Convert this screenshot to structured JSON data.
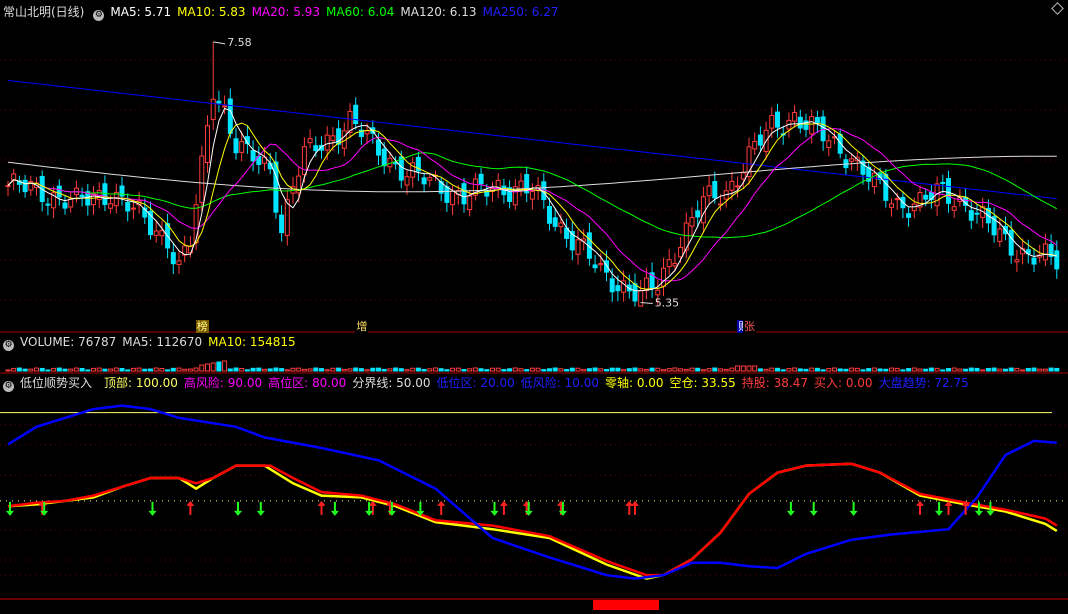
{
  "colors": {
    "background": "#000000",
    "grid": "#6a0000",
    "candle_up": "#ff3b3b",
    "candle_down": "#00e5ff",
    "ma5": "#ffffff",
    "ma10": "#ffff00",
    "ma20": "#ff00ff",
    "ma60": "#00ff00",
    "ma120": "#dddddd",
    "ma250": "#0000ff",
    "sell_line": "#ffff00",
    "buy_line": "#ff0000",
    "market_line": "#0000ff",
    "level_line": "#ffff66"
  },
  "price_header": {
    "title": "常山北明(日线)",
    "items": [
      {
        "label": "MA5: 5.71",
        "color": "#ffffff"
      },
      {
        "label": "MA10: 5.83",
        "color": "#ffff00"
      },
      {
        "label": "MA20: 5.93",
        "color": "#ff00ff"
      },
      {
        "label": "MA60: 6.04",
        "color": "#00ff00"
      },
      {
        "label": "MA120: 6.13",
        "color": "#dddddd"
      },
      {
        "label": "MA250: 6.27",
        "color": "#2020ff"
      }
    ]
  },
  "volume_header": {
    "items": [
      {
        "label": "VOLUME: 76787",
        "color": "#dddddd"
      },
      {
        "label": "MA5: 112670",
        "color": "#dddddd"
      },
      {
        "label": "MA10: 154815",
        "color": "#ffff00"
      }
    ]
  },
  "indicator_header": {
    "title": "低位顺势买入",
    "items": [
      {
        "label": "顶部: 100.00",
        "color": "#ffff66"
      },
      {
        "label": "高风险: 90.00",
        "color": "#ff00ff"
      },
      {
        "label": "高位区: 80.00",
        "color": "#ff00ff"
      },
      {
        "label": "分界线: 50.00",
        "color": "#dddddd"
      },
      {
        "label": "低位区: 20.00",
        "color": "#2020ff"
      },
      {
        "label": "低风险: 10.00",
        "color": "#2020ff"
      },
      {
        "label": "零轴: 0.00",
        "color": "#ffff00"
      },
      {
        "label": "空仓: 33.55",
        "color": "#ffff00"
      },
      {
        "label": "持股: 38.47",
        "color": "#ff3b3b"
      },
      {
        "label": "买入: 0.00",
        "color": "#ff3b3b"
      },
      {
        "label": "大盘趋势: 72.75",
        "color": "#2020ff"
      }
    ]
  },
  "event_tags": [
    {
      "text": "榜",
      "index": 34,
      "bg": "#7a5a00",
      "color": "#ffff80"
    },
    {
      "text": "增",
      "index": 62,
      "bg": "#000000",
      "color": "#ffdd66"
    },
    {
      "text": "财",
      "index": 129,
      "bg": "#0000aa",
      "color": "#ffffff"
    },
    {
      "text": "张",
      "index": 130,
      "bg": "#000000",
      "color": "#ff5555"
    }
  ],
  "chart_data": [
    {
      "type": "candlestick",
      "title": "常山北明(日线)",
      "ylim": [
        5.2,
        7.75
      ],
      "candles": [],
      "max_label": "7.58",
      "min_label": "5.35",
      "moving_averages": [
        "MA5",
        "MA10",
        "MA20",
        "MA60",
        "MA120",
        "MA250"
      ]
    },
    {
      "type": "bar",
      "title": "VOLUME",
      "values_relative": "small bars near zero after a spike near the MA labels"
    },
    {
      "type": "line",
      "title": "低位顺势买入",
      "ylim": [
        -5,
        110
      ],
      "levels": [
        100,
        50,
        0
      ],
      "series": [
        {
          "name": "空仓",
          "points": [
            [
              0,
              47
            ],
            [
              5,
              48
            ],
            [
              10,
              50
            ],
            [
              15,
              52
            ],
            [
              20,
              58
            ],
            [
              25,
              63
            ],
            [
              30,
              63
            ],
            [
              33,
              57
            ],
            [
              36,
              63
            ],
            [
              40,
              70
            ],
            [
              45,
              70
            ],
            [
              50,
              60
            ],
            [
              55,
              53
            ],
            [
              62,
              52
            ],
            [
              68,
              47
            ],
            [
              75,
              38
            ],
            [
              85,
              34
            ],
            [
              95,
              29
            ],
            [
              105,
              14
            ],
            [
              112,
              6
            ],
            [
              115,
              8
            ],
            [
              120,
              17
            ],
            [
              125,
              32
            ],
            [
              130,
              54
            ],
            [
              135,
              66
            ],
            [
              140,
              70
            ],
            [
              148,
              71
            ],
            [
              153,
              66
            ],
            [
              160,
              53
            ],
            [
              168,
              48
            ],
            [
              175,
              44
            ],
            [
              182,
              37
            ],
            [
              184,
              33
            ]
          ]
        },
        {
          "name": "持股",
          "points": [
            [
              0,
              47
            ],
            [
              5,
              49
            ],
            [
              10,
              50
            ],
            [
              15,
              53
            ],
            [
              20,
              58
            ],
            [
              25,
              63
            ],
            [
              30,
              63
            ],
            [
              33,
              60
            ],
            [
              36,
              63
            ],
            [
              40,
              70
            ],
            [
              46,
              70
            ],
            [
              50,
              63
            ],
            [
              55,
              55
            ],
            [
              62,
              53
            ],
            [
              68,
              48
            ],
            [
              75,
              39
            ],
            [
              85,
              36
            ],
            [
              95,
              30
            ],
            [
              105,
              16
            ],
            [
              112,
              8
            ],
            [
              115,
              8
            ],
            [
              120,
              17
            ],
            [
              125,
              32
            ],
            [
              130,
              54
            ],
            [
              135,
              66
            ],
            [
              140,
              70
            ],
            [
              148,
              71
            ],
            [
              153,
              66
            ],
            [
              160,
              54
            ],
            [
              168,
              49
            ],
            [
              175,
              45
            ],
            [
              182,
              40
            ],
            [
              184,
              36
            ]
          ]
        },
        {
          "name": "大盘趋势",
          "points": [
            [
              0,
              82
            ],
            [
              5,
              92
            ],
            [
              10,
              97
            ],
            [
              15,
              102
            ],
            [
              20,
              104
            ],
            [
              25,
              102
            ],
            [
              30,
              97
            ],
            [
              40,
              92
            ],
            [
              45,
              86
            ],
            [
              55,
              80
            ],
            [
              65,
              73
            ],
            [
              75,
              57
            ],
            [
              80,
              43
            ],
            [
              85,
              29
            ],
            [
              95,
              18
            ],
            [
              105,
              8
            ],
            [
              110,
              6
            ],
            [
              115,
              8
            ],
            [
              120,
              15
            ],
            [
              125,
              15
            ],
            [
              130,
              13
            ],
            [
              135,
              12
            ],
            [
              140,
              20
            ],
            [
              148,
              28
            ],
            [
              155,
              31
            ],
            [
              165,
              34
            ],
            [
              170,
              52
            ],
            [
              175,
              76
            ],
            [
              180,
              84
            ],
            [
              184,
              83
            ]
          ]
        }
      ],
      "buy_arrow_indices": [
        6,
        32,
        55,
        64,
        67,
        76,
        87,
        91,
        97,
        109,
        110,
        160,
        165,
        168
      ],
      "sell_arrow_indices": [
        0,
        6,
        25,
        40,
        44,
        57,
        63,
        67,
        72,
        85,
        91,
        97,
        137,
        141,
        148,
        163,
        170,
        172
      ]
    }
  ]
}
